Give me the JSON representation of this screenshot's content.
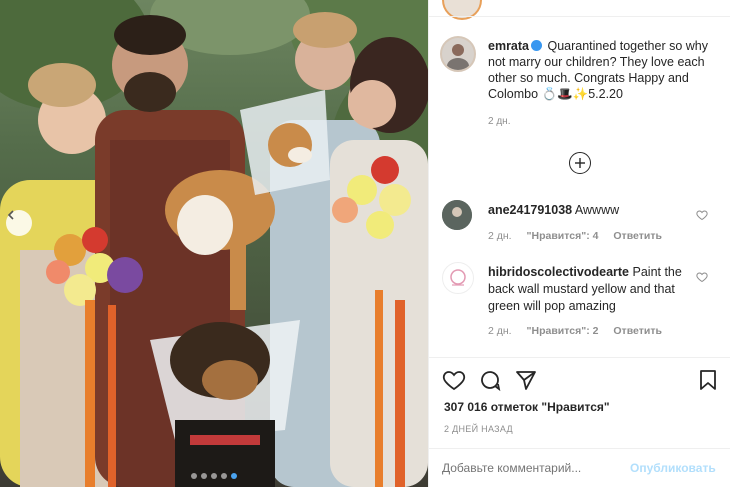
{
  "photo": {
    "carousel_dots": 5,
    "active_dot": 4
  },
  "post": {
    "username": "emrata",
    "caption": "Quarantined together so why not marry our children? They love each other so much. Congrats Happy and Colombo 💍🎩✨5.2.20",
    "time": "2 дн.",
    "likes": "307 016 отметок \"Нравится\"",
    "posted": "2 ДНЕЙ НАЗАД",
    "comment_placeholder": "Добавьте комментарий...",
    "publish_label": "Опубликовать"
  },
  "comments": [
    {
      "username": "ane241791038",
      "text": "Awwww",
      "time": "2 дн.",
      "likes": "\"Нравится\": 4",
      "reply": "Ответить"
    },
    {
      "username": "hibridoscolectivodearte",
      "text": "Paint the back wall mustard yellow and that green will pop amazing",
      "time": "2 дн.",
      "likes": "\"Нравится\": 2",
      "reply": "Ответить"
    }
  ],
  "colors": {
    "accent": "#3897f0",
    "publish": "#b2dffc",
    "text": "#262626",
    "muted": "#8e8e8e"
  }
}
